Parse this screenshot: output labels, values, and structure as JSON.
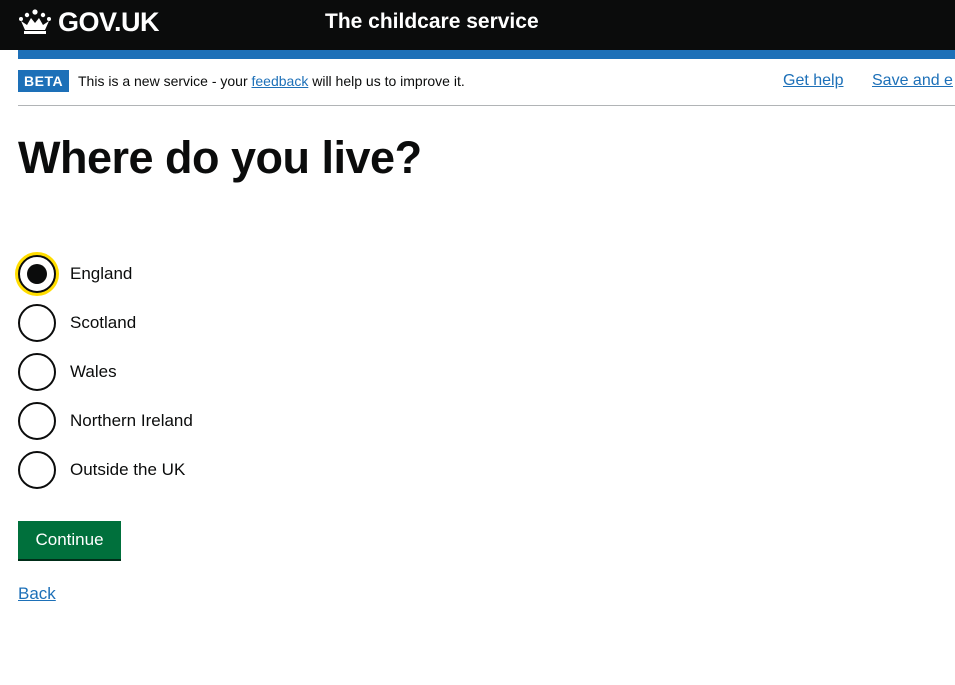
{
  "header": {
    "logo_text": "GOV.UK",
    "service_name": "The childcare service"
  },
  "phase_banner": {
    "tag": "BETA",
    "text_before": "This is a new service - your ",
    "feedback_link": "feedback",
    "text_after": " will help us to improve it.",
    "help_link": "Get help",
    "save_link": "Save and e"
  },
  "main": {
    "heading": "Where do you live?",
    "radios": [
      {
        "label": "England",
        "checked": true
      },
      {
        "label": "Scotland",
        "checked": false
      },
      {
        "label": "Wales",
        "checked": false
      },
      {
        "label": "Northern Ireland",
        "checked": false
      },
      {
        "label": "Outside the UK",
        "checked": false
      }
    ],
    "continue_label": "Continue",
    "back_label": "Back"
  },
  "colors": {
    "header_bg": "#0b0c0c",
    "brand_blue": "#1d70b8",
    "button_green": "#00703c",
    "focus_yellow": "#ffdd00"
  },
  "icons": {
    "logo": "crown-icon"
  }
}
